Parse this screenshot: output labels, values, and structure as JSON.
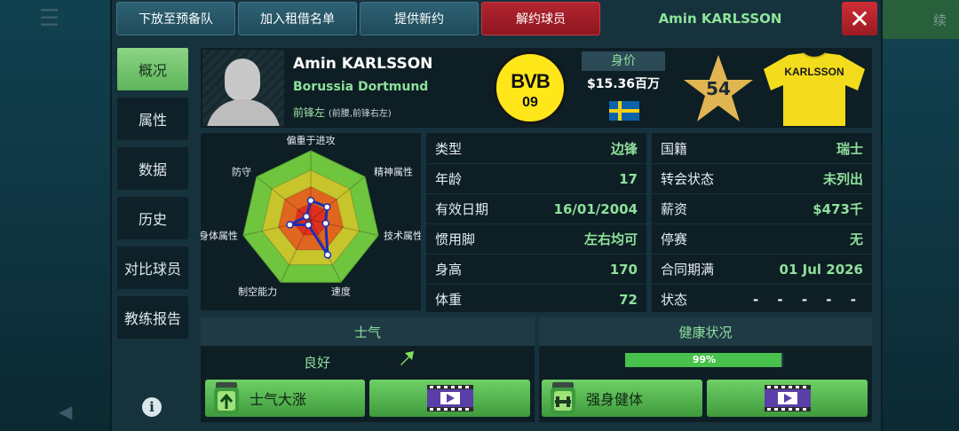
{
  "top_buttons": {
    "reserve": "下放至预备队",
    "loan": "加入租借名单",
    "contract": "提供新约",
    "release": "解约球员"
  },
  "player_title": "Amin KARLSSON",
  "background_hint": "续",
  "side_tabs": [
    "概况",
    "属性",
    "数据",
    "历史",
    "对比球员",
    "教练报告"
  ],
  "player": {
    "name": "Amin KARLSSON",
    "club": "Borussia Dortmund",
    "position": "前锋左",
    "position_alt": "(前腰,前锋右左)",
    "club_badge_text": "BVB",
    "club_badge_number": "09",
    "value_label": "身价",
    "value": "$15.36百万",
    "rating": "54",
    "shirt_name": "KARLSSON"
  },
  "radar": {
    "labels": [
      "偏重于进攻",
      "精神属性",
      "技术属性",
      "速度",
      "制空能力",
      "身体属性",
      "防守"
    ],
    "values": [
      0.28,
      0.3,
      0.22,
      0.56,
      0.08,
      0.31,
      0.08
    ],
    "colors": {
      "outer": "#6fc53e",
      "mid": "#c7c42c",
      "inner": "#e0651f",
      "center": "#e0301c",
      "line": "#1c2db5"
    }
  },
  "info_left": [
    {
      "k": "类型",
      "v": "边锋"
    },
    {
      "k": "年龄",
      "v": "17"
    },
    {
      "k": "有效日期",
      "v": "16/01/2004"
    },
    {
      "k": "惯用脚",
      "v": "左右均可"
    },
    {
      "k": "身高",
      "v": "170"
    },
    {
      "k": "体重",
      "v": "72"
    }
  ],
  "info_right": [
    {
      "k": "国籍",
      "v": "瑞士"
    },
    {
      "k": "转会状态",
      "v": "未列出"
    },
    {
      "k": "薪资",
      "v": "$473千"
    },
    {
      "k": "停赛",
      "v": "无"
    },
    {
      "k": "合同期满",
      "v": "01 Jul 2026"
    },
    {
      "k": "状态",
      "v": "- - - - -"
    }
  ],
  "morale": {
    "title": "士气",
    "value": "良好",
    "button": "士气大涨"
  },
  "health": {
    "title": "健康状况",
    "percent_label": "99%",
    "percent": 0.99,
    "button": "强身健体"
  },
  "colors": {
    "accent_green": "#8ee09b",
    "button_green": "#5fb45a",
    "danger_red": "#b32430"
  }
}
